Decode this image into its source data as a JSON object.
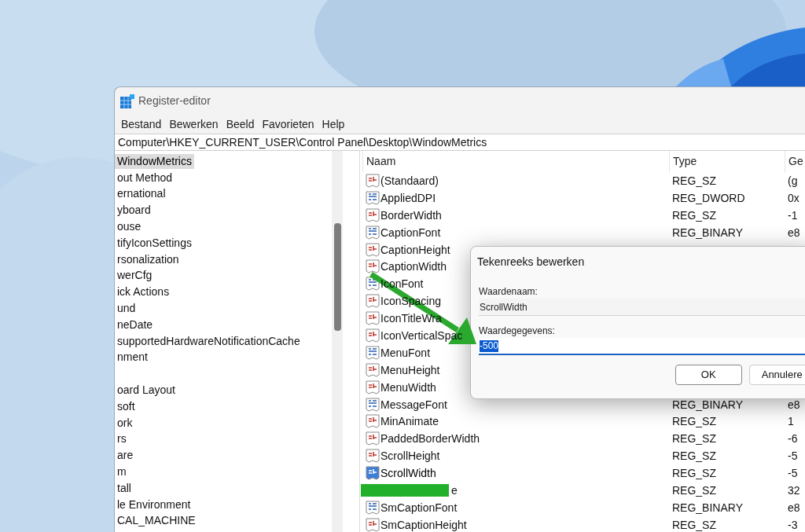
{
  "window": {
    "title": "Register-editor"
  },
  "menu": [
    "Bestand",
    "Bewerken",
    "Beeld",
    "Favorieten",
    "Help"
  ],
  "address_bar": "Computer\\HKEY_CURRENT_USER\\Control Panel\\Desktop\\WindowMetrics",
  "tree": {
    "items": [
      {
        "label": "WindowMetrics",
        "selected": true
      },
      {
        "label": "out Method",
        "selected": false
      },
      {
        "label": "ernational",
        "selected": false
      },
      {
        "label": "yboard",
        "selected": false
      },
      {
        "label": "ouse",
        "selected": false
      },
      {
        "label": "tifyIconSettings",
        "selected": false
      },
      {
        "label": "rsonalization",
        "selected": false
      },
      {
        "label": "werCfg",
        "selected": false
      },
      {
        "label": "ick Actions",
        "selected": false
      },
      {
        "label": "und",
        "selected": false
      },
      {
        "label": "neDate",
        "selected": false
      },
      {
        "label": "supportedHardwareNotificationCache",
        "selected": false
      },
      {
        "label": "nment",
        "selected": false
      },
      {
        "selected": false
      },
      {
        "label": "oard Layout",
        "selected": false
      },
      {
        "label": "soft",
        "selected": false
      },
      {
        "label": "ork",
        "selected": false
      },
      {
        "label": "rs",
        "selected": false
      },
      {
        "label": "are",
        "selected": false
      },
      {
        "label": "m",
        "selected": false
      },
      {
        "label": "tall",
        "selected": false
      },
      {
        "label": "le Environment",
        "selected": false
      },
      {
        "label": "CAL_MACHINE",
        "selected": false
      }
    ]
  },
  "values": {
    "columns": [
      "Naam",
      "Type",
      "Ge"
    ],
    "rows": [
      {
        "kind": "string",
        "name": "(Standaard)",
        "type": "REG_SZ",
        "data": "(g",
        "selected": false
      },
      {
        "kind": "binary",
        "name": "AppliedDPI",
        "type": "REG_DWORD",
        "data": "0x",
        "selected": false
      },
      {
        "kind": "string",
        "name": "BorderWidth",
        "type": "REG_SZ",
        "data": "-1",
        "selected": false
      },
      {
        "kind": "binary",
        "name": "CaptionFont",
        "type": "REG_BINARY",
        "data": "e8",
        "selected": false
      },
      {
        "kind": "string",
        "name": "CaptionHeight",
        "selected": false
      },
      {
        "kind": "string",
        "name": "CaptionWidth",
        "selected": false
      },
      {
        "kind": "binary",
        "name": "IconFont",
        "selected": false
      },
      {
        "kind": "string",
        "name": "IconSpacing",
        "selected": false
      },
      {
        "kind": "string",
        "name": "IconTitleWra",
        "selected": false
      },
      {
        "kind": "string",
        "name": "IconVerticalSpac",
        "selected": false
      },
      {
        "kind": "binary",
        "name": "MenuFont",
        "selected": false
      },
      {
        "kind": "string",
        "name": "MenuHeight",
        "selected": false
      },
      {
        "kind": "string",
        "name": "MenuWidth",
        "selected": false
      },
      {
        "kind": "binary",
        "name": "MessageFont",
        "type": "REG_BINARY",
        "data": "e8",
        "selected": false
      },
      {
        "kind": "string",
        "name": "MinAnimate",
        "type": "REG_SZ",
        "data": "1",
        "selected": false
      },
      {
        "kind": "string",
        "name": "PaddedBorderWidth",
        "type": "REG_SZ",
        "data": "-6",
        "selected": false
      },
      {
        "kind": "string",
        "name": "ScrollHeight",
        "type": "REG_SZ",
        "data": "-5",
        "selected": false
      },
      {
        "kind": "string",
        "name": "ScrollWidth",
        "type": "REG_SZ",
        "data": "-5",
        "selected": true
      },
      {
        "kind": "redacted",
        "name": "e",
        "type": "REG_SZ",
        "data": "32",
        "selected": false
      },
      {
        "kind": "binary",
        "name": "SmCaptionFont",
        "type": "REG_BINARY",
        "data": "e8",
        "selected": false
      },
      {
        "kind": "string",
        "name": "SmCaptionHeight",
        "type": "REG_SZ",
        "data": "-3",
        "selected": false
      }
    ]
  },
  "dialog": {
    "title": "Tekenreeks bewerken",
    "name_label": "Waardenaam:",
    "name_value": "ScrollWidth",
    "data_label": "Waardegegevens:",
    "data_value": "-500",
    "buttons": [
      "OK",
      "Annulere"
    ]
  }
}
